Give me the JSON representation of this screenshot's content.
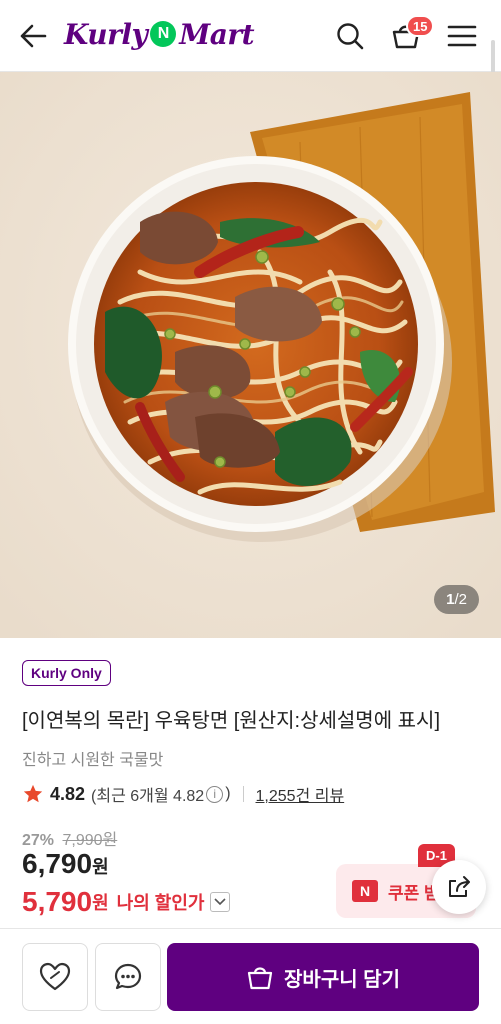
{
  "header": {
    "logo_left": "Kurly",
    "logo_badge": "N",
    "logo_right": "Mart",
    "cart_count": "15"
  },
  "hero": {
    "page_current": "1",
    "page_separator": "/",
    "page_total": "2"
  },
  "product": {
    "tag": "Kurly Only",
    "title": "[이연복의 목란] 우육탕면 [원산지:상세설명에 표시]",
    "subtitle": "진하고 시원한 국물맛",
    "rating": "4.82",
    "recent_prefix": "(최근 6개월 4.82",
    "recent_suffix": ")",
    "info_icon": "i",
    "review_count": "1,255건 리뷰",
    "discount_pct": "27%",
    "original_price": "7,990원",
    "price": "6,790",
    "price_unit": "원",
    "my_price": "5,790",
    "my_price_unit": "원",
    "my_price_label": "나의 할인가"
  },
  "coupon": {
    "badge": "N",
    "label": "쿠폰 받",
    "dday": "D-1"
  },
  "bottom_bar": {
    "cart_button_label": "장바구니 담기"
  },
  "colors": {
    "brand_purple": "#5f0080",
    "sale_red": "#e0303c",
    "naver_green": "#03c75a",
    "badge_red": "#f04e4e"
  }
}
